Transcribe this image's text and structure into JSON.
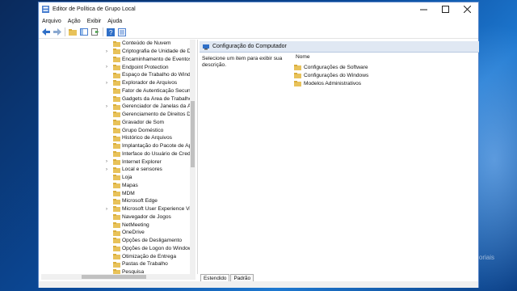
{
  "window": {
    "title": "Editor de Política de Grupo Local",
    "controls": [
      "minimize-icon",
      "maximize-icon",
      "close-icon"
    ]
  },
  "menu": [
    "Arquivo",
    "Ação",
    "Exibir",
    "Ajuda"
  ],
  "toolbar_icons": [
    "back-icon",
    "forward-icon",
    "up-folder-icon",
    "show-tree-icon",
    "export-list-icon",
    "help-icon",
    "properties-icon"
  ],
  "tree": {
    "items": [
      {
        "label": "Conteúdo de Nuvem",
        "expandable": false
      },
      {
        "label": "Criptografia de Unidade de Di",
        "expandable": true
      },
      {
        "label": "Encaminhamento de Eventos",
        "expandable": false
      },
      {
        "label": "Endpoint Protection",
        "expandable": true
      },
      {
        "label": "Espaço de Trabalho do Windo",
        "expandable": false
      },
      {
        "label": "Explorador de Arquivos",
        "expandable": true
      },
      {
        "label": "Fator de Autenticação Secund",
        "expandable": false
      },
      {
        "label": "Gadgets da Área de Trabalho",
        "expandable": false
      },
      {
        "label": "Gerenciador de Janelas da Áre",
        "expandable": true
      },
      {
        "label": "Gerenciamento de Direitos Di",
        "expandable": false
      },
      {
        "label": "Gravador de Som",
        "expandable": false
      },
      {
        "label": "Grupo Doméstico",
        "expandable": false
      },
      {
        "label": "Histórico de Arquivos",
        "expandable": false
      },
      {
        "label": "Implantação do Pacote de Ap",
        "expandable": false
      },
      {
        "label": "Interface do Usuário de Crede",
        "expandable": false
      },
      {
        "label": "Internet Explorer",
        "expandable": true
      },
      {
        "label": "Local e sensores",
        "expandable": true
      },
      {
        "label": "Loja",
        "expandable": false
      },
      {
        "label": "Mapas",
        "expandable": false
      },
      {
        "label": "MDM",
        "expandable": false
      },
      {
        "label": "Microsoft Edge",
        "expandable": false
      },
      {
        "label": "Microsoft User Experience Virt",
        "expandable": true
      },
      {
        "label": "Navegador de Jogos",
        "expandable": false
      },
      {
        "label": "NetMeeting",
        "expandable": false
      },
      {
        "label": "OneDrive",
        "expandable": false
      },
      {
        "label": "Opções de Desligamento",
        "expandable": false
      },
      {
        "label": "Opções de Logon do Window",
        "expandable": false
      },
      {
        "label": "Otimização de Entrega",
        "expandable": false
      },
      {
        "label": "Pastas de Trabalho",
        "expandable": false
      },
      {
        "label": "Pesquisa",
        "expandable": false
      }
    ]
  },
  "right_panel": {
    "header": "Configuração do Computador",
    "description": "Selecione um item para exibir sua descrição.",
    "column_header": "Nome",
    "items": [
      "Configurações de Software",
      "Configurações do Windows",
      "Modelos Administrativos"
    ]
  },
  "tabs": [
    {
      "label": "Estendido",
      "active": true
    },
    {
      "label": "Padrão",
      "active": false
    }
  ],
  "watermark": "PH Tutoriais",
  "colors": {
    "folder": "#e8c25a",
    "header_bg": "#e0e8f3",
    "accent": "#1f5fbf"
  }
}
